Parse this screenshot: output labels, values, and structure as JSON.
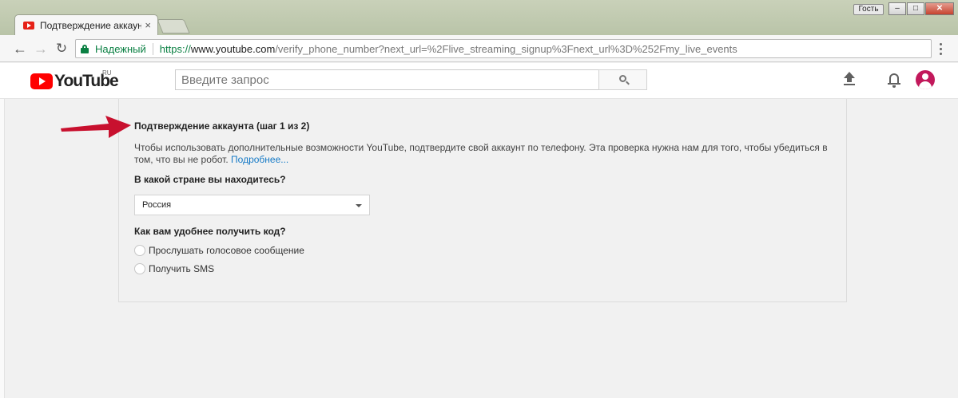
{
  "browser": {
    "tab_title": "Подтверждение аккаунт",
    "tab_close": "×",
    "guest_label": "Гость",
    "window_controls": {
      "minimize": "–",
      "maximize": "□",
      "close": "✕"
    },
    "nav": {
      "back": "←",
      "forward": "→",
      "reload": "↻"
    },
    "address": {
      "secure_label": "Надежный",
      "url_protocol": "https://",
      "url_host": "www.youtube.com",
      "url_rest": "/verify_phone_number?next_url=%2Flive_streaming_signup%3Fnext_url%3D%252Fmy_live_events"
    }
  },
  "youtube_header": {
    "logo_text": "YouTube",
    "region": "RU",
    "search_placeholder": "Введите запрос"
  },
  "verification": {
    "title": "Подтверждение аккаунта (шаг 1 из 2)",
    "description": "Чтобы использовать дополнительные возможности YouTube, подтвердите свой аккаунт по телефону. Эта проверка нужна нам для того, чтобы убедиться в том, что вы не робот.",
    "learn_more": "Подробнее...",
    "country_question": "В какой стране вы находитесь?",
    "country_selected": "Россия",
    "method_question": "Как вам удобнее получить код?",
    "options": [
      {
        "label": "Прослушать голосовое сообщение",
        "checked": false
      },
      {
        "label": "Получить SMS",
        "checked": false
      }
    ]
  },
  "colors": {
    "youtube_red": "#ff0000",
    "secure_green": "#0b8043",
    "link_blue": "#167ac6",
    "annotation_red": "#c8102e",
    "avatar": "#c2185b"
  },
  "icons": [
    "youtube-favicon-icon",
    "lock-icon",
    "search-icon",
    "upload-icon",
    "bell-icon",
    "avatar-icon",
    "chevron-down-icon",
    "menu-icon",
    "annotation-arrow-icon"
  ]
}
